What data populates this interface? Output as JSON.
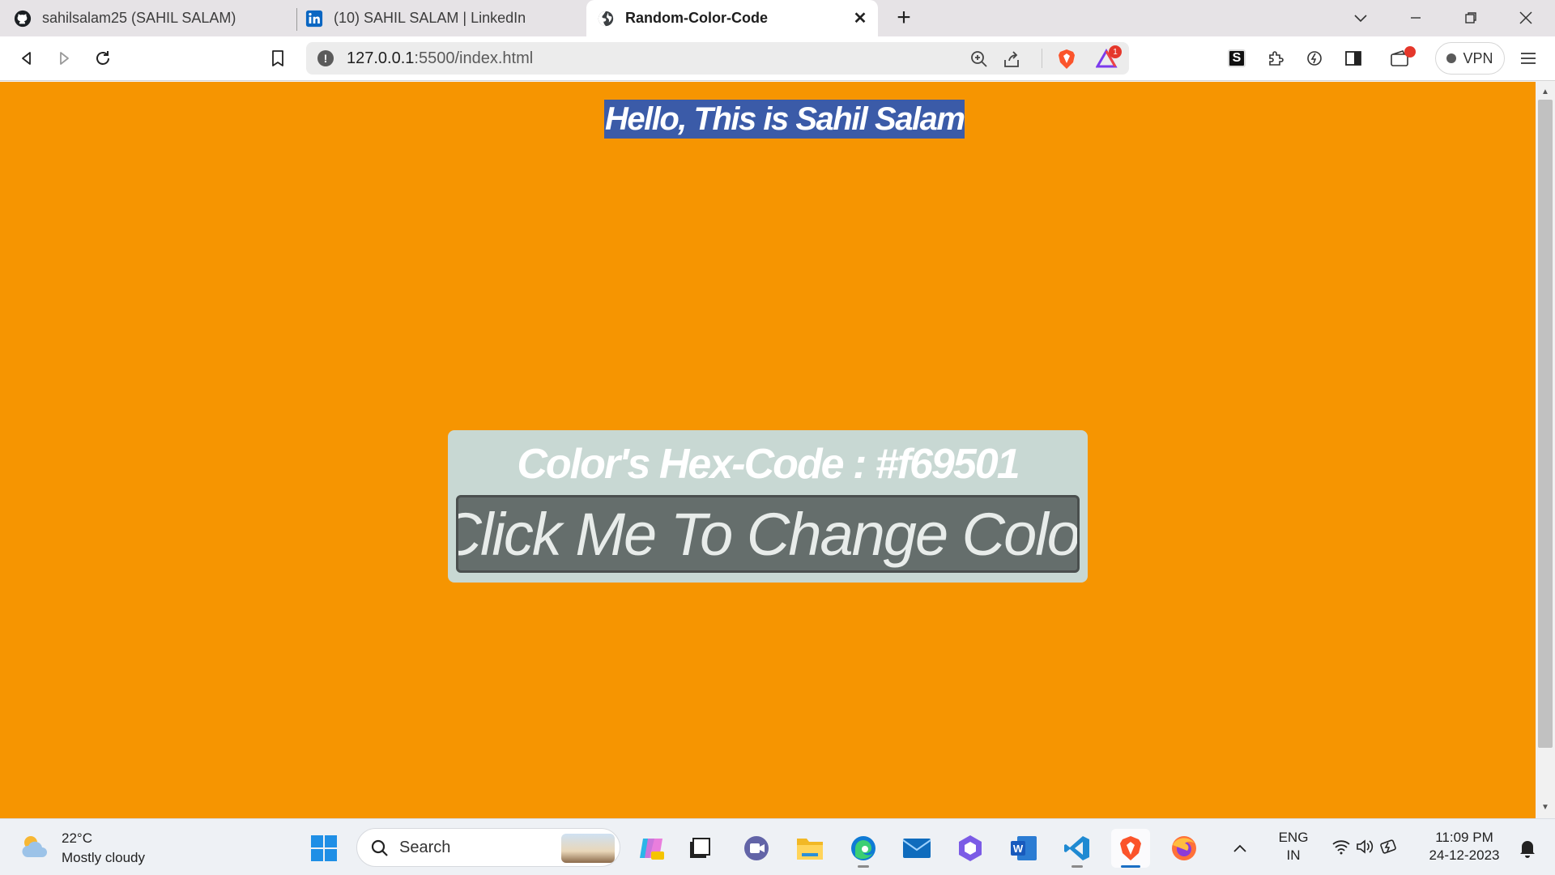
{
  "browser": {
    "tabs": [
      {
        "title": "sahilsalam25 (SAHIL SALAM)",
        "icon": "github-icon"
      },
      {
        "title": "(10) SAHIL SALAM | LinkedIn",
        "icon": "linkedin-icon"
      },
      {
        "title": "Random-Color-Code",
        "icon": "globe-icon",
        "active": true
      }
    ],
    "url": {
      "host": "127.0.0.1",
      "path": ":5500/index.html"
    },
    "brave_rewards_badge": "1",
    "vpn_label": "VPN"
  },
  "page": {
    "background_color": "#f69501",
    "heading": "Hello, This is Sahil Salam",
    "hex_label": "Color's Hex-Code : #f69501",
    "button_label": "Click Me To Change Color"
  },
  "taskbar": {
    "weather": {
      "temp": "22°C",
      "condition": "Mostly cloudy"
    },
    "search_placeholder": "Search",
    "language": {
      "lang": "ENG",
      "region": "IN"
    },
    "clock": {
      "time": "11:09 PM",
      "date": "24-12-2023"
    }
  },
  "colors": {
    "accent_blue": "#3b5ba8",
    "card_bg": "#c8d8d3",
    "button_bg": "#656e6c"
  }
}
